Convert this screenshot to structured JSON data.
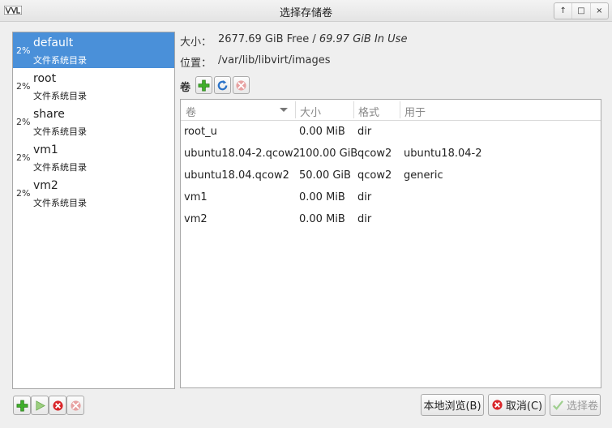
{
  "window": {
    "title": "选择存储卷",
    "buttons": [
      "↑",
      "□",
      "×"
    ]
  },
  "pools": [
    {
      "usage": "2%",
      "name": "default",
      "description": "文件系统目录",
      "selected": true
    },
    {
      "usage": "2%",
      "name": "root",
      "description": "文件系统目录",
      "selected": false
    },
    {
      "usage": "2%",
      "name": "share",
      "description": "文件系统目录",
      "selected": false
    },
    {
      "usage": "2%",
      "name": "vm1",
      "description": "文件系统目录",
      "selected": false
    },
    {
      "usage": "2%",
      "name": "vm2",
      "description": "文件系统目录",
      "selected": false
    }
  ],
  "details": {
    "size_label": "大小：",
    "size_free": "2677.69 GiB Free / ",
    "size_in_use": "69.97 GiB In Use",
    "location_label": "位置：",
    "location_value": "/var/lib/libvirt/images"
  },
  "volumes_section": {
    "label": "卷"
  },
  "volume_table": {
    "headers": [
      "卷",
      "大小",
      "格式",
      "用于"
    ],
    "rows": [
      {
        "name": "root_u",
        "size": "0.00 MiB",
        "format": "dir",
        "used_by": ""
      },
      {
        "name": "ubuntu18.04-2.qcow2",
        "size": "100.00 GiB",
        "format": "qcow2",
        "used_by": "ubuntu18.04-2"
      },
      {
        "name": "ubuntu18.04.qcow2",
        "size": "50.00 GiB",
        "format": "qcow2",
        "used_by": "generic"
      },
      {
        "name": "vm1",
        "size": "0.00 MiB",
        "format": "dir",
        "used_by": ""
      },
      {
        "name": "vm2",
        "size": "0.00 MiB",
        "format": "dir",
        "used_by": ""
      }
    ]
  },
  "footer": {
    "browse_local": "本地浏览(B)",
    "cancel": "取消(C)",
    "choose_volume": "选择卷"
  },
  "colors": {
    "selection": "#4a90d9",
    "add_green": "#3fae2a",
    "delete_red": "#d9262a",
    "refresh_blue": "#2a72c8"
  }
}
